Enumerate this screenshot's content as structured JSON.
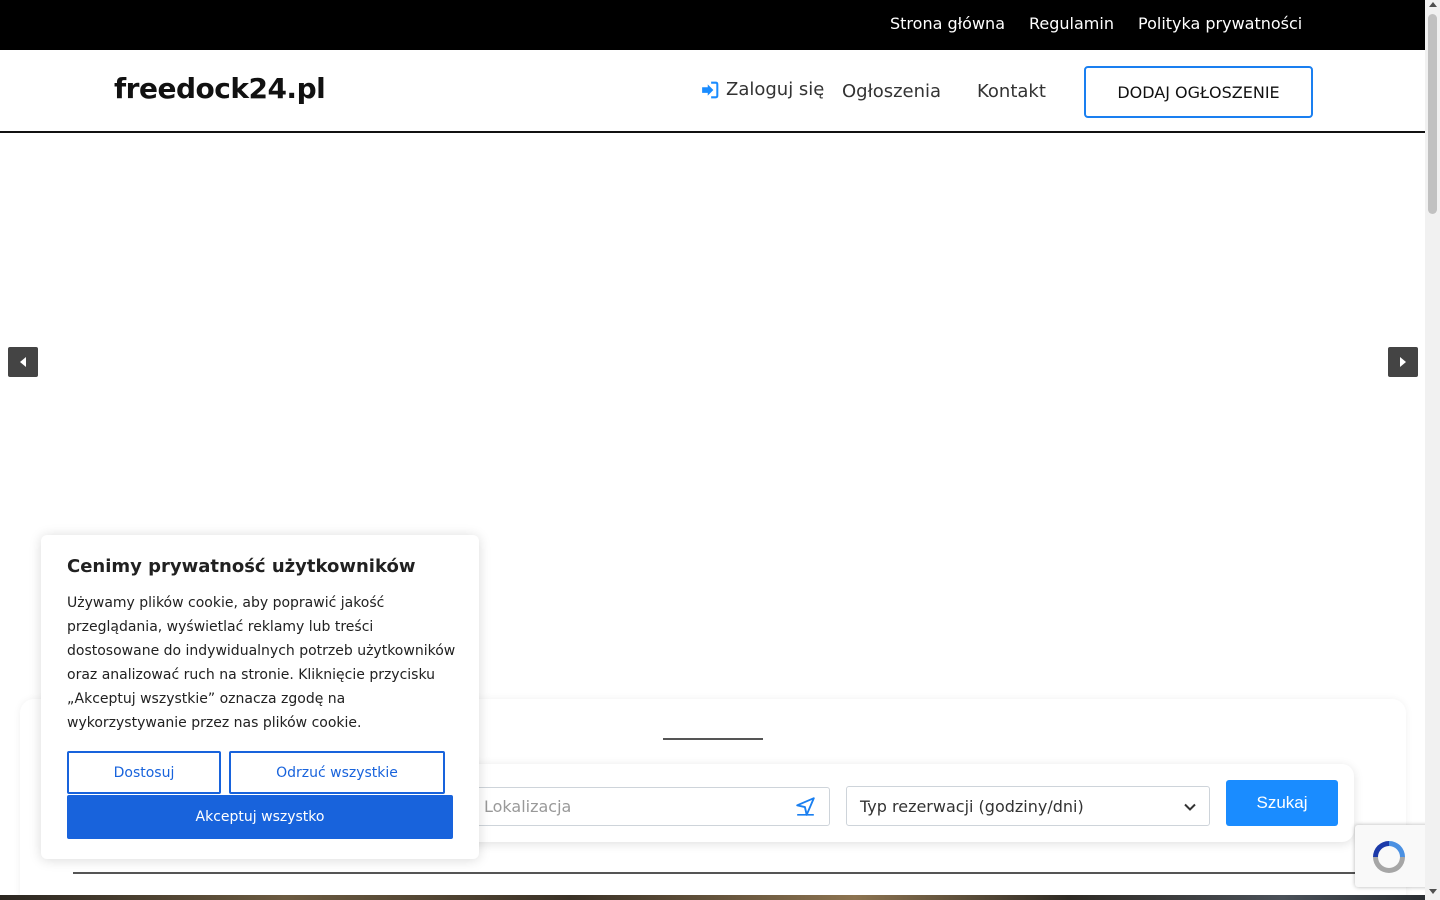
{
  "topbar": {
    "links": [
      "Strona główna",
      "Regulamin",
      "Polityka prywatności"
    ]
  },
  "header": {
    "logo": "freedock24.pl",
    "login_label": "Zaloguj się",
    "nav": [
      "Ogłoszenia",
      "Kontakt"
    ],
    "add_button": "DODAJ OGŁOSZENIE"
  },
  "search": {
    "location_placeholder": "Lokalizacja",
    "reservation_type": "Typ rezerwacji (godziny/dni)",
    "submit_label": "Szukaj"
  },
  "cookie": {
    "title": "Cenimy prywatność użytkowników",
    "text": "Używamy plików cookie, aby poprawić jakość przeglądania, wyświetlać reklamy lub treści dostosowane do indywidualnych potrzeb użytkowników oraz analizować ruch na stronie. Kliknięcie przycisku „Akceptuj wszystkie” oznacza zgodę na wykorzystywanie przez nas plików cookie.",
    "customize": "Dostosuj",
    "reject": "Odrzuć wszystkie",
    "accept": "Akceptuj wszystko"
  },
  "colors": {
    "accent": "#1a8cff",
    "cookie_accent": "#1863dc",
    "topbar": "#000000"
  },
  "icons": {
    "login": "sign-in-icon",
    "location": "location-arrow-icon",
    "select": "chevron-down-icon",
    "carousel_prev": "caret-left-icon",
    "carousel_next": "caret-right-icon",
    "recaptcha": "recaptcha-logo-icon"
  }
}
